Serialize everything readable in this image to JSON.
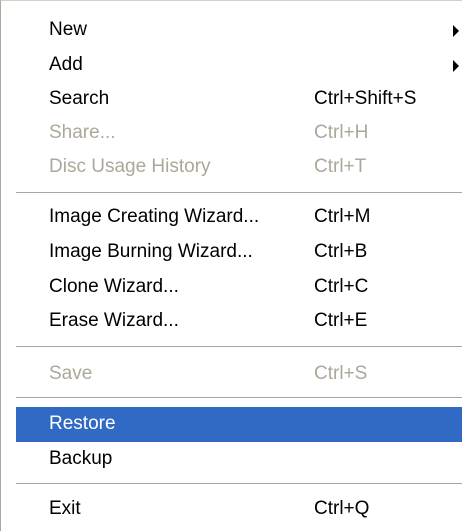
{
  "menu": {
    "items": [
      {
        "label": "New",
        "shortcut": "",
        "submenu": true,
        "state": "enabled"
      },
      {
        "label": "Add",
        "shortcut": "",
        "submenu": true,
        "state": "enabled"
      },
      {
        "label": "Search",
        "shortcut": "Ctrl+Shift+S",
        "submenu": false,
        "state": "enabled"
      },
      {
        "label": "Share...",
        "shortcut": "Ctrl+H",
        "submenu": false,
        "state": "disabled"
      },
      {
        "label": "Disc Usage History",
        "shortcut": "Ctrl+T",
        "submenu": false,
        "state": "disabled"
      },
      {
        "label": "Image Creating Wizard...",
        "shortcut": "Ctrl+M",
        "submenu": false,
        "state": "enabled"
      },
      {
        "label": "Image Burning Wizard...",
        "shortcut": "Ctrl+B",
        "submenu": false,
        "state": "enabled"
      },
      {
        "label": "Clone Wizard...",
        "shortcut": "Ctrl+C",
        "submenu": false,
        "state": "enabled"
      },
      {
        "label": "Erase Wizard...",
        "shortcut": "Ctrl+E",
        "submenu": false,
        "state": "enabled"
      },
      {
        "label": "Save",
        "shortcut": "Ctrl+S",
        "submenu": false,
        "state": "disabled"
      },
      {
        "label": "Restore",
        "shortcut": "",
        "submenu": false,
        "state": "highlighted"
      },
      {
        "label": "Backup",
        "shortcut": "",
        "submenu": false,
        "state": "enabled"
      },
      {
        "label": "Exit",
        "shortcut": "Ctrl+Q",
        "submenu": false,
        "state": "enabled"
      }
    ]
  },
  "colors": {
    "highlight": "#316ac5",
    "highlight_text": "#ffffff",
    "disabled_text": "#aca899",
    "separator": "#aca899"
  }
}
